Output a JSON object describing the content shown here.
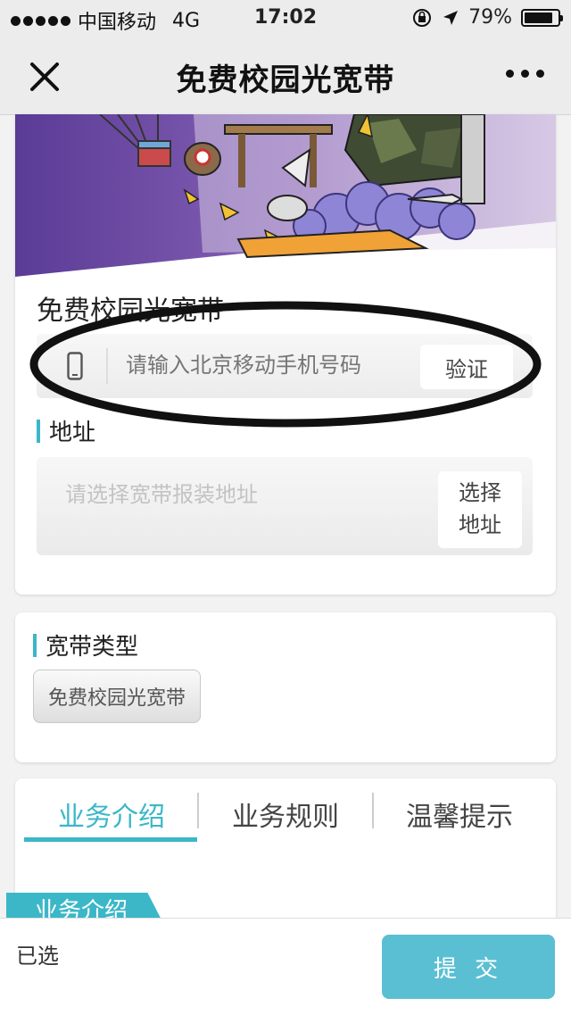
{
  "status_bar": {
    "carrier": "中国移动",
    "network": "4G",
    "time": "17:02",
    "battery": "79%",
    "battery_level": 0.79
  },
  "nav": {
    "title": "免费校园光宽带"
  },
  "form": {
    "section_title": "免费校园光宽带",
    "phone_placeholder": "请输入北京移动手机号码",
    "verify_label": "验证",
    "address_label": "地址",
    "address_placeholder": "请选择宽带报装地址",
    "select_address_line1": "选择",
    "select_address_line2": "地址"
  },
  "broadband": {
    "label": "宽带类型",
    "option": "免费校园光宽带"
  },
  "tabs": {
    "items": [
      "业务介绍",
      "业务规则",
      "温馨提示"
    ],
    "active_index": 0,
    "ribbon": "业务介绍"
  },
  "bottom": {
    "selected_label": "已选",
    "submit_label": "提 交"
  },
  "colors": {
    "accent": "#3bb7c8",
    "submit": "#5bbfd3"
  }
}
